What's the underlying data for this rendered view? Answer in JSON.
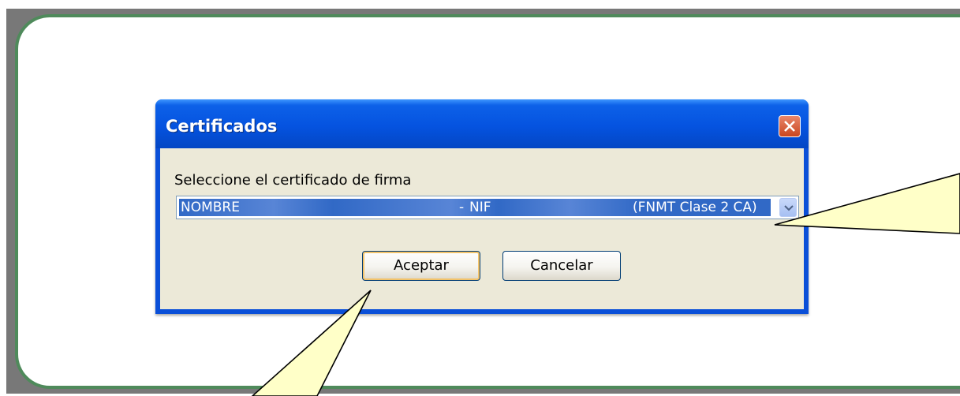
{
  "dialog": {
    "title": "Certificados",
    "prompt": "Seleccione el certificado de firma",
    "certificate_select": {
      "label_name": "NOMBRE",
      "label_nif": "NIF",
      "label_issuer": "(FNMT Clase 2 CA)"
    },
    "accept_label": "Aceptar",
    "cancel_label": "Cancelar"
  },
  "colors": {
    "titlebar": "#0553e0",
    "client": "#ece9d8",
    "selection": "#3169c6",
    "callout_fill": "#ffffc8",
    "panel_border": "#4f8a5b"
  },
  "icons": [
    "close-icon",
    "chevron-down-icon"
  ]
}
